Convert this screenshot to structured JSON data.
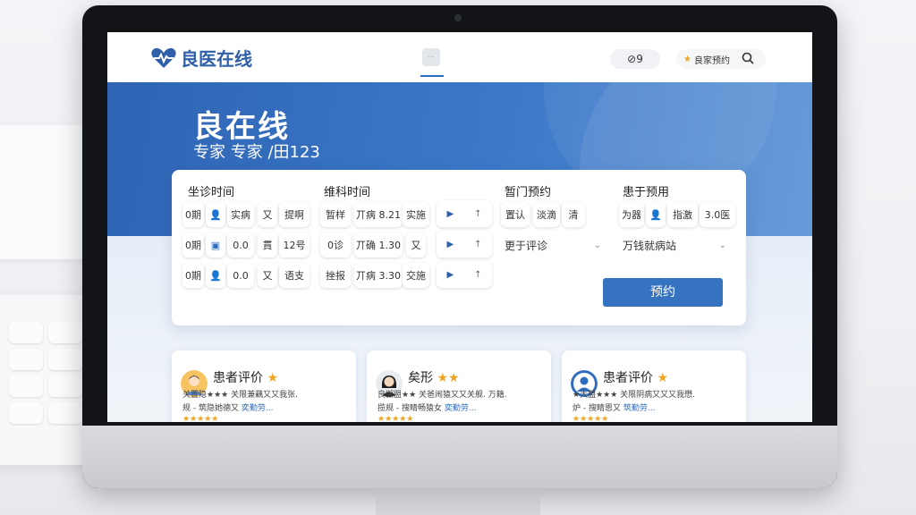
{
  "nav": {
    "logo_text": "良医在线",
    "tab_label": "···",
    "pill_label": "⊘9",
    "fav_label": "良家预约"
  },
  "hero": {
    "title": "良在线",
    "subtitle": "专家 专家 /田123"
  },
  "booking": {
    "col_time": "坐诊时间",
    "col_dept": "维科时间",
    "col_type": "暂门预约",
    "col_patient": "患于预用",
    "rows": [
      {
        "a": "0期",
        "b": "实病",
        "c": "又",
        "d": "提啊",
        "e": "暂样",
        "f": "丌病 8.21",
        "g": "实施"
      },
      {
        "a": "0期",
        "b": "0.0",
        "c": "貫",
        "d": "12号",
        "e": "0诊",
        "f": "丌确 1.30",
        "g": "又"
      },
      {
        "a": "0期",
        "b": "0.0",
        "c": "又",
        "d": "语支",
        "e": "挫报",
        "f": "丌病 3.30",
        "g": "交施"
      }
    ],
    "type_chips": [
      "置认",
      "淡滴",
      "清"
    ],
    "patient_chips": [
      "为器",
      "指激",
      "3.0医"
    ],
    "select_type": "更于评诊",
    "select_patient": "万钱就病站",
    "book_button": "预约"
  },
  "reviews": [
    {
      "title": "患者评价",
      "line1": "关置隐★★★ 关限兼藕又又我张.",
      "line2": "规 - 筑隐她德又 ",
      "line2_link": "奕勤劳...",
      "line3": "★★★★★"
    },
    {
      "title": "矣形",
      "line1": "良懈盟★★ 关爸闹猿又又关舰. 万籍.",
      "line2": "揽规 - 搜睛畅猿女 ",
      "line2_link": "奕勤劳...",
      "line3": "★★★★★"
    },
    {
      "title": "患者评价",
      "line1": "★大盟★★★ 关限阴病又又又我懋.",
      "line2": "炉 - 搜睛恩又 ",
      "line2_link": "筑勤劳...",
      "line3": "★★★★★"
    }
  ],
  "colors": {
    "brand": "#2e5fa8",
    "accent": "#3573c0",
    "star": "#f0a521"
  }
}
